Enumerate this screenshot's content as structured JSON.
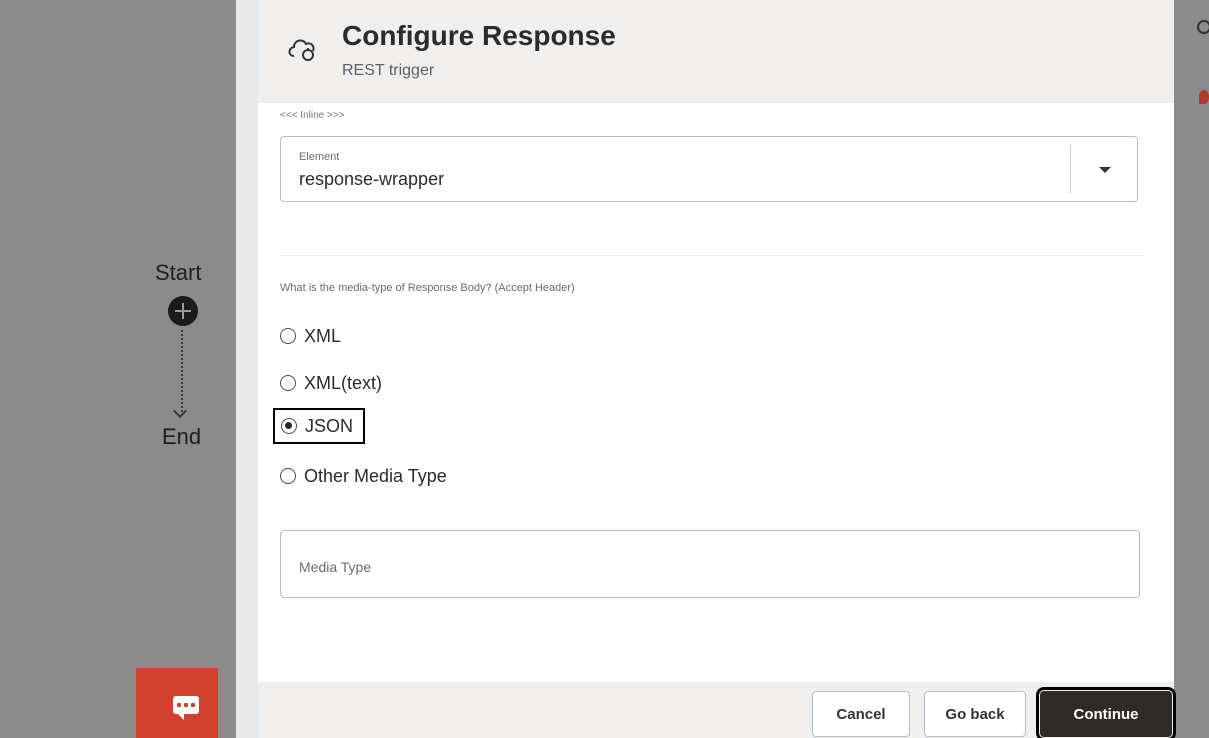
{
  "canvas": {
    "start_label": "Start",
    "end_label": "End"
  },
  "modal": {
    "title": "Configure Response",
    "subtitle": "REST trigger",
    "inline_note": "<<< Inline >>>",
    "element_field": {
      "label": "Element",
      "value": "response-wrapper"
    },
    "question": "What is the media-type of Response Body? (Accept Header)",
    "media_options": [
      {
        "label": "XML",
        "checked": false
      },
      {
        "label": "XML(text)",
        "checked": false
      },
      {
        "label": "JSON",
        "checked": true
      },
      {
        "label": "Other Media Type",
        "checked": false
      }
    ],
    "media_type_placeholder": "Media Type"
  },
  "footer": {
    "cancel_label": "Cancel",
    "goback_label": "Go back",
    "continue_label": "Continue"
  },
  "colors": {
    "chat_button": "#d1402f",
    "continue_button": "#2f2b28",
    "header_bg": "#f1efed"
  }
}
